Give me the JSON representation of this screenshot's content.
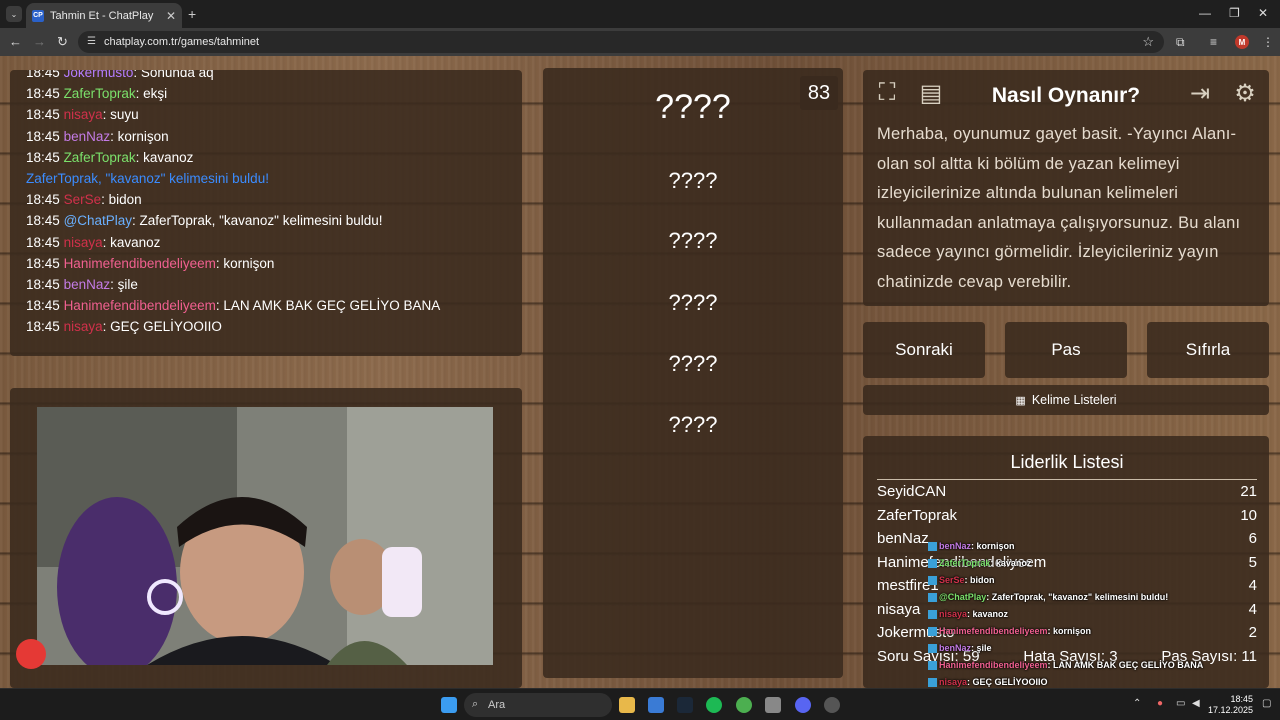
{
  "browser": {
    "tab_title": "Tahmin Et - ChatPlay",
    "favicon_text": "CP",
    "url": "chatplay.com.tr/games/tahminet",
    "profile_initial": "M"
  },
  "chat": {
    "lines": [
      {
        "time": "18:45",
        "user": "Jokermusto",
        "user_color": "#b57cff",
        "text": ": Sonunda aq"
      },
      {
        "time": "18:45",
        "user": "ZaferToprak",
        "user_color": "#7be06b",
        "text": ": ekşi"
      },
      {
        "time": "18:45",
        "user": "nisaya",
        "user_color": "#d0314b",
        "text": ": suyu"
      },
      {
        "time": "18:45",
        "user": "benNaz",
        "user_color": "#c47be6",
        "text": ": kornişon"
      },
      {
        "time": "18:45",
        "user": "ZaferToprak",
        "user_color": "#7be06b",
        "text": ": kavanoz"
      },
      {
        "time": "",
        "user": "",
        "user_color": "#3b8cff",
        "text": "ZaferToprak, \"kavanoz\" kelimesini buldu!",
        "system": true
      },
      {
        "time": "18:45",
        "user": "SerSe",
        "user_color": "#d0314b",
        "text": ": bidon"
      },
      {
        "time": "18:45",
        "user": "@ChatPlay",
        "user_color": "#6ab0ff",
        "text": ": ZaferToprak, \"kavanoz\" kelimesini buldu!"
      },
      {
        "time": "18:45",
        "user": "nisaya",
        "user_color": "#d0314b",
        "text": ": kavanoz"
      },
      {
        "time": "18:45",
        "user": "Hanimefendibendeliyeem",
        "user_color": "#f06090",
        "text": ": kornişon"
      },
      {
        "time": "18:45",
        "user": "benNaz",
        "user_color": "#c47be6",
        "text": ": şile"
      },
      {
        "time": "18:45",
        "user": "Hanimefendibendeliyeem",
        "user_color": "#f06090",
        "text": ": LAN AMK BAK GEÇ GELİYO BANA"
      },
      {
        "time": "18:45",
        "user": "nisaya",
        "user_color": "#d0314b",
        "text": ": GEÇ GELİYOOIIO"
      }
    ]
  },
  "game": {
    "counter": "83",
    "words": [
      "????",
      "????",
      "????",
      "????",
      "????",
      "????"
    ]
  },
  "howto": {
    "title": "Nasıl Oynanır?",
    "text": "Merhaba, oyunumuz gayet basit. -Yayıncı Alanı- olan sol altta ki bölüm de yazan kelimeyi izleyicilerinize altında bulunan kelimeleri kullanmadan anlatmaya çalışıyorsunuz. Bu alanı sadece yayıncı görmelidir. İzleyicileriniz yayın chatinizde cevap verebilir."
  },
  "actions": {
    "next": "Sonraki",
    "pass": "Pas",
    "reset": "Sıfırla",
    "word_lists": "Kelime Listeleri"
  },
  "leaderboard": {
    "title": "Liderlik Listesi",
    "rows": [
      {
        "name": "SeyidCAN",
        "score": "21"
      },
      {
        "name": "ZaferToprak",
        "score": "10"
      },
      {
        "name": "benNaz",
        "score": "6"
      },
      {
        "name": "Hanimefendibendeliyeem",
        "score": "5"
      },
      {
        "name": "mestfire1",
        "score": "4"
      },
      {
        "name": "nisaya",
        "score": "4"
      },
      {
        "name": "Jokermusto",
        "score": "2"
      }
    ],
    "questions": "Soru Sayısı: 59",
    "errors": "Hata Sayısı: 3",
    "passes": "Pas Sayısı: 11"
  },
  "overlay": [
    {
      "user": "benNaz",
      "color": "#c47be6",
      "text": ": kornişon"
    },
    {
      "user": "ZaferToprak",
      "color": "#7be06b",
      "text": ": kavanoz"
    },
    {
      "user": "SerSe",
      "color": "#d0314b",
      "text": ": bidon"
    },
    {
      "user": "@ChatPlay",
      "color": "#7be06b",
      "text": ": ZaferToprak, \"kavanoz\" kelimesini buldu!"
    },
    {
      "user": "nisaya",
      "color": "#d0314b",
      "text": ": kavanoz"
    },
    {
      "user": "Hanimefendibendeliyeem",
      "color": "#f06090",
      "text": ": kornişon"
    },
    {
      "user": "benNaz",
      "color": "#c47be6",
      "text": ": şile"
    },
    {
      "user": "Hanimefendibendeliyeem",
      "color": "#f06090",
      "text": ": LAN AMK BAK GEÇ GELİYO BANA"
    },
    {
      "user": "nisaya",
      "color": "#d0314b",
      "text": ": GEÇ GELİYOOIIO"
    }
  ],
  "taskbar": {
    "search_placeholder": "Ara",
    "time": "18:45",
    "date": "17.12.2025"
  }
}
